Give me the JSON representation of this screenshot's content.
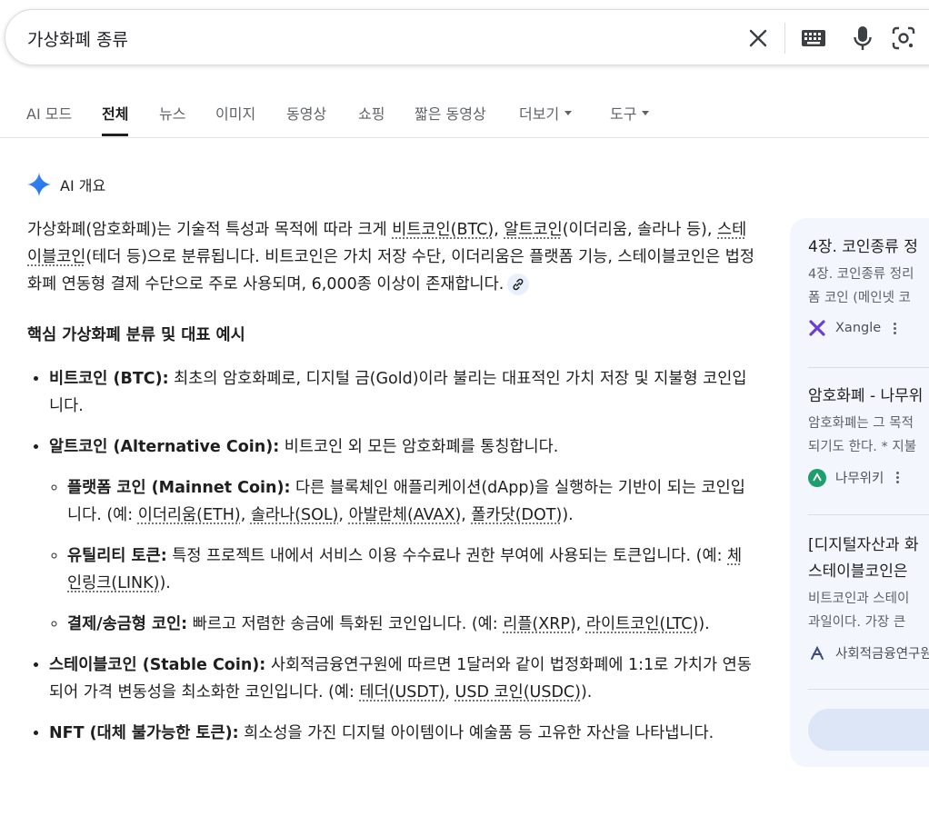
{
  "search": {
    "query": "가상화폐 종류"
  },
  "tabs": [
    {
      "label": "AI 모드"
    },
    {
      "label": "전체"
    },
    {
      "label": "뉴스"
    },
    {
      "label": "이미지"
    },
    {
      "label": "동영상"
    },
    {
      "label": "쇼핑"
    },
    {
      "label": "짧은 동영상"
    },
    {
      "label": "더보기"
    },
    {
      "label": "도구"
    }
  ],
  "active_tab": "전체",
  "ai": {
    "header": "AI 개요",
    "intro": {
      "t1": "가상화폐(암호화폐)는 기술적 특성과 목적에 따라 크게 ",
      "l1": "비트코인(BTC)",
      "t2": ", ",
      "l2": "알트코인",
      "t3": "(이더리움, 솔라나 등), ",
      "l3": "스테이블코인",
      "t4": "(테더 등)으로 분류됩니다. 비트코인은 가치 저장 수단, 이더리움은 플랫폼 기능, 스테이블코인은 법정화폐 연동형 결제 수단으로 주로 사용되며, 6,000종 이상이 존재합니다."
    },
    "heading": "핵심 가상화폐 분류 및 대표 예시",
    "btc": {
      "bold": "비트코인 (BTC):",
      "text": " 최초의 암호화폐로, 디지털 금(Gold)이라 불리는 대표적인 가치 저장 및 지불형 코인입니다."
    },
    "alt": {
      "bold": "알트코인 (Alternative Coin):",
      "text": " 비트코인 외 모든 암호화폐를 통칭합니다."
    },
    "platform": {
      "bold": "플랫폼 코인 (Mainnet Coin):",
      "text": " 다른 블록체인 애플리케이션(dApp)을 실행하는 기반이 되는 코인입니다. (예: ",
      "l1": "이더리움(ETH)",
      "s1": ", ",
      "l2": "솔라나(SOL)",
      "s2": ", ",
      "l3": "아발란체(AVAX)",
      "s3": ", ",
      "l4": "폴카닷(DOT)",
      "end": ")."
    },
    "utility": {
      "bold": "유틸리티 토큰:",
      "text": " 특정 프로젝트 내에서 서비스 이용 수수료나 권한 부여에 사용되는 토큰입니다. (예: ",
      "l1": "체인링크(LINK)",
      "end": ")."
    },
    "payment": {
      "bold": "결제/송금형 코인:",
      "text": " 빠르고 저렴한 송금에 특화된 코인입니다. (예: ",
      "l1": "리플(XRP)",
      "s1": ", ",
      "l2": "라이트코인(LTC)",
      "end": ")."
    },
    "stable": {
      "bold": "스테이블코인 (Stable Coin):",
      "text": " 사회적금융연구원에 따르면 1달러와 같이 법정화폐에 1:1로 가치가 연동되어 가격 변동성을 최소화한 코인입니다. (예: ",
      "l1": "테더(USDT)",
      "s1": ", ",
      "l2": "USD 코인(USDC)",
      "end": ")."
    },
    "nft": {
      "bold": "NFT (대체 불가능한 토큰):",
      "text": " 희소성을 가진 디지털 아이템이나 예술품 등 고유한 자산을 나타냅니다."
    }
  },
  "side": {
    "cards": [
      {
        "title": "4장. 코인종류 정",
        "snippet": [
          "4장. 코인종류 정리",
          "폼 코인 (메인넷 코"
        ],
        "source": "Xangle",
        "icon": "xangle-logo-icon"
      },
      {
        "title": "암호화폐 - 나무위",
        "snippet": [
          "암호화폐는 그 목적",
          "되기도 한다. * 지불"
        ],
        "source": "나무위키",
        "icon": "namuwiki-logo-icon"
      },
      {
        "title": [
          "[디지털자산과 화",
          "스테이블코인은"
        ],
        "snippet": [
          "비트코인과 스테이",
          "과일이다. 가장 큰"
        ],
        "source": "사회적금융연구원",
        "icon": "social-finance-logo-icon"
      }
    ]
  },
  "colors": {
    "accent": "#1a73e8",
    "text": "#1f1f1f",
    "muted": "#5f6368",
    "panel": "#f3f6fc"
  }
}
